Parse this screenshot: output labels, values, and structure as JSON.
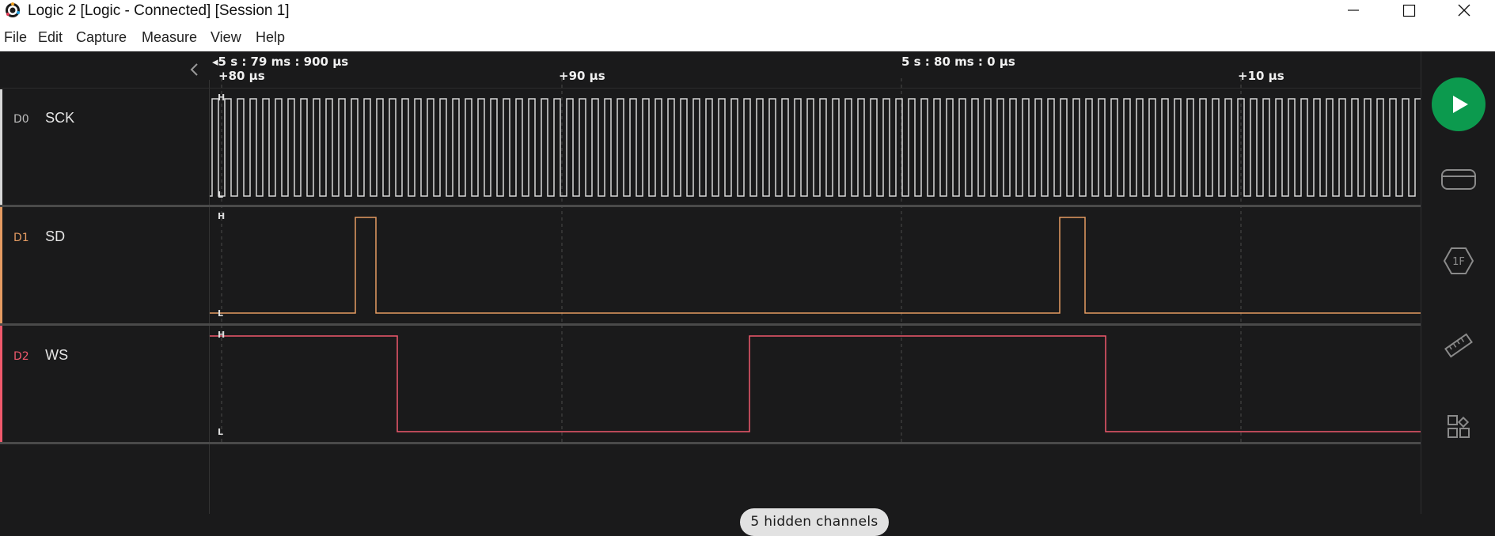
{
  "window": {
    "title": "Logic 2 [Logic - Connected] [Session 1]",
    "minimize_icon": "minimize-icon",
    "maximize_icon": "maximize-icon",
    "close_icon": "close-icon"
  },
  "menu": {
    "items": [
      "File",
      "Edit",
      "Capture",
      "Measure",
      "View",
      "Help"
    ]
  },
  "timeline": {
    "prev_marker": "◂",
    "absolute_labels": [
      "5 s : 79 ms : 900 µs",
      "5 s : 80 ms : 0 µs"
    ],
    "relative_labels": [
      "+80 µs",
      "+90 µs",
      "+10 µs"
    ]
  },
  "channels": [
    {
      "id": "D0",
      "name": "SCK",
      "color": "#d8d8d8",
      "high": "H",
      "low": "L"
    },
    {
      "id": "D1",
      "name": "SD",
      "color": "#e59b62",
      "high": "H",
      "low": "L"
    },
    {
      "id": "D2",
      "name": "WS",
      "color": "#f0596c",
      "high": "H",
      "low": "L"
    }
  ],
  "hidden_channels_label": "5 hidden channels",
  "sidebar": {
    "icons": [
      "play-icon",
      "device-icon",
      "analyzers-icon",
      "measure-icon",
      "extensions-icon"
    ],
    "play_color": "#0c9a4e"
  }
}
